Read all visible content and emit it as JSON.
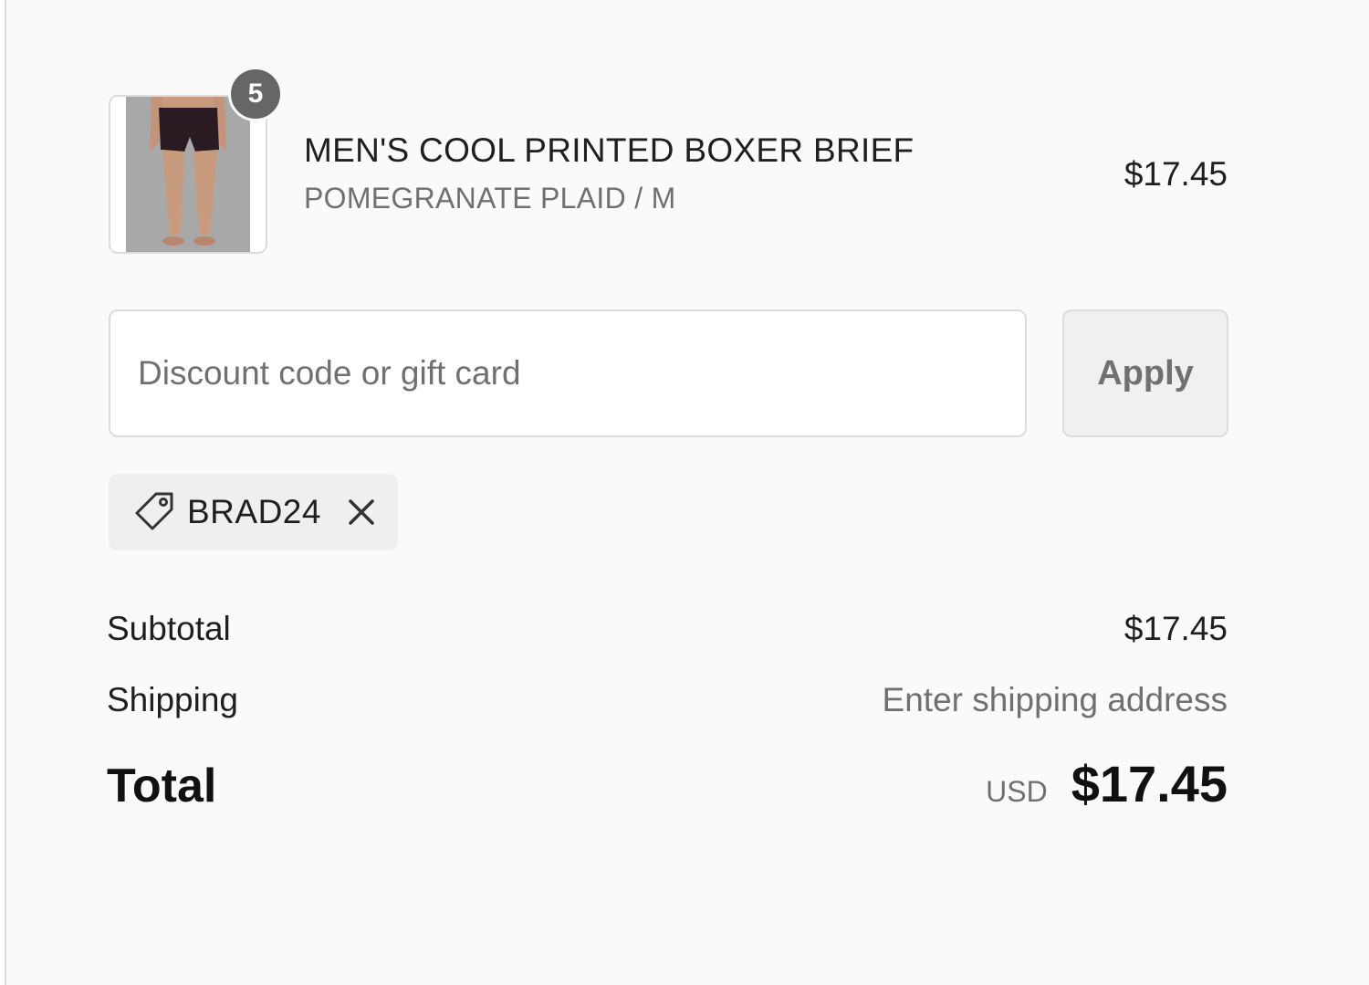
{
  "line_item": {
    "quantity": "5",
    "name": "MEN'S COOL PRINTED BOXER BRIEF",
    "variant": "POMEGRANATE PLAID / M",
    "price": "$17.45"
  },
  "discount": {
    "placeholder": "Discount code or gift card",
    "value": "",
    "apply_label": "Apply"
  },
  "applied_code": {
    "code": "BRAD24"
  },
  "summary": {
    "subtotal_label": "Subtotal",
    "subtotal_value": "$17.45",
    "shipping_label": "Shipping",
    "shipping_value": "Enter shipping address",
    "total_label": "Total",
    "currency": "USD",
    "total_value": "$17.45"
  },
  "colors": {
    "background": "#fafafa",
    "badge": "#666666",
    "muted_text": "#707070"
  },
  "icons": {
    "tag": "tag-icon",
    "remove": "close-icon"
  }
}
